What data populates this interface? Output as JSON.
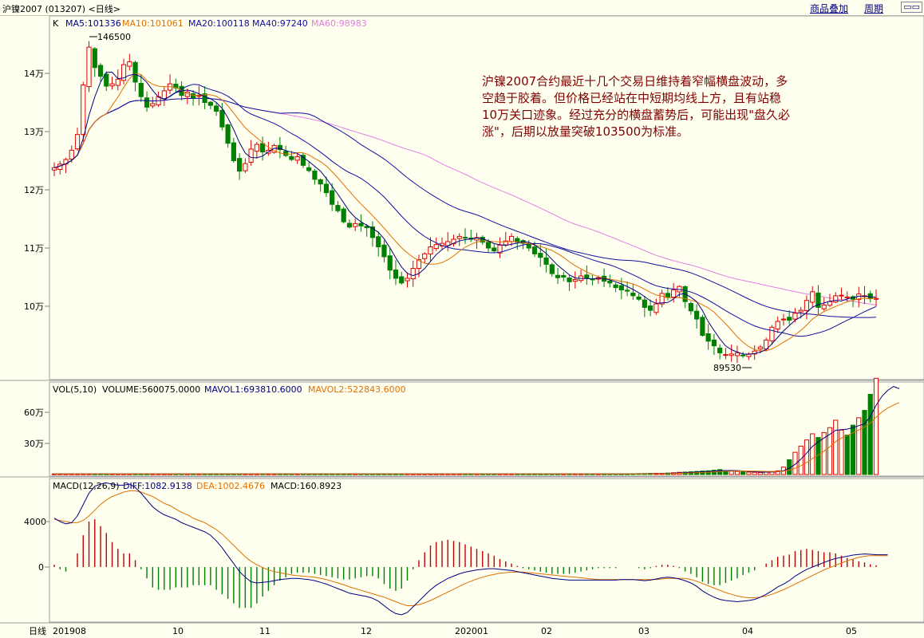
{
  "header": {
    "title": "沪镍2007 (013207) <日线>",
    "overlay_label": "商品叠加",
    "period_label": "周期",
    "window_icons": "▭▭"
  },
  "main_panel": {
    "k_label": "K",
    "ma": [
      {
        "label": "MA5:101336",
        "color": "#000080"
      },
      {
        "label": "MA10:101061",
        "color": "#e07000"
      },
      {
        "label": "MA20:100118",
        "color": "#1010a0"
      },
      {
        "label": "MA40:97240",
        "color": "#1010a0"
      },
      {
        "label": "MA60:98983",
        "color": "#e080e0"
      }
    ],
    "y_ticks": [
      "14万",
      "13万",
      "12万",
      "11万",
      "10万"
    ],
    "high_mark": "146500",
    "low_mark": "89530",
    "annotation": [
      "沪镍2007合约最近十几个交易日维持着窄幅横盘波动，多",
      "空趋于胶着。但价格已经站在中短期均线上方，且有站稳",
      "10万关口迹象。经过充分的横盘蓄势后，可能出现\"盘久必",
      "涨\"，后期以放量突破103500为标准。"
    ]
  },
  "vol_panel": {
    "label": "VOL(5,10)",
    "volume": "VOLUME:560075.0000",
    "mavol1": "MAVOL1:693810.6000",
    "mavol2": "MAVOL2:522843.6000",
    "y_ticks": [
      "60万",
      "30万"
    ]
  },
  "macd_panel": {
    "label": "MACD(12,26,9)",
    "diff": "DIFF:1082.9138",
    "dea": "DEA:1002.4676",
    "macd": "MACD:160.8923",
    "y_ticks": [
      "4000",
      "0"
    ]
  },
  "x_axis": {
    "period": "日线",
    "labels": [
      "201908",
      "10",
      "11",
      "12",
      "202001",
      "02",
      "03",
      "04",
      "05"
    ]
  },
  "chart_data": {
    "type": "candlestick",
    "price_ylim": [
      88000,
      148500
    ],
    "close_seq": [
      123800,
      124400,
      125200,
      126800,
      129500,
      138000,
      144500,
      141000,
      139500,
      137800,
      138200,
      139000,
      141500,
      142000,
      138500,
      136000,
      134200,
      134800,
      136000,
      137000,
      138200,
      137500,
      136200,
      136800,
      135800,
      136200,
      135000,
      134500,
      133500,
      130800,
      128000,
      125000,
      123200,
      124500,
      127000,
      127800,
      126500,
      126800,
      127600,
      126900,
      125900,
      125200,
      125700,
      124200,
      123300,
      121800,
      121000,
      119500,
      117500,
      116400,
      114500,
      113600,
      114200,
      113800,
      113500,
      111800,
      110200,
      108500,
      106200,
      104800,
      104000,
      104800,
      106500,
      108000,
      109000,
      110200,
      110600,
      110800,
      111100,
      111500,
      112000,
      111800,
      111500,
      111800,
      111000,
      110000,
      109500,
      110500,
      111200,
      112000,
      111000,
      110800,
      110000,
      109000,
      108400,
      107200,
      105600,
      104900,
      105000,
      104200,
      104600,
      105200,
      104800,
      104600,
      104900,
      104300,
      104000,
      103200,
      102800,
      102600,
      101800,
      101200,
      99800,
      99300,
      100400,
      102200,
      101500,
      102800,
      103400,
      100800,
      99200,
      97800,
      95000,
      94000,
      93200,
      92000,
      91700,
      91800,
      92000,
      91500,
      91800,
      92300,
      93000,
      94200,
      96400,
      97400,
      97800,
      97600,
      98800,
      99300,
      101000,
      102500,
      99800,
      100200,
      100800,
      101800,
      101900,
      101600,
      101200,
      102100,
      101800,
      101300,
      101336
    ],
    "vol_ylim": [
      0,
      750000
    ],
    "volume_seq": [
      5000,
      5000,
      5000,
      5000,
      5000,
      5000,
      5000,
      5000,
      5000,
      5000,
      5000,
      5000,
      5000,
      5000,
      5000,
      5000,
      5000,
      5000,
      5000,
      5000,
      5000,
      5000,
      5000,
      5000,
      5000,
      5000,
      5000,
      5000,
      5000,
      5000,
      5000,
      5000,
      5000,
      5000,
      5000,
      5000,
      5000,
      5000,
      5000,
      5000,
      5000,
      5000,
      5000,
      5000,
      5000,
      5000,
      5000,
      5000,
      5000,
      5000,
      5000,
      5000,
      5000,
      5000,
      5000,
      5000,
      5000,
      5000,
      5000,
      5000,
      5000,
      5000,
      5000,
      5000,
      5000,
      5000,
      5000,
      5000,
      5000,
      5000,
      5000,
      5000,
      5000,
      5000,
      5000,
      5000,
      5000,
      5000,
      5000,
      5000,
      5000,
      5000,
      5000,
      5000,
      5000,
      5000,
      5000,
      5000,
      5000,
      5000,
      5000,
      5000,
      5000,
      5000,
      5000,
      5000,
      5000,
      5000,
      5000,
      5000,
      6000,
      7000,
      8000,
      9000,
      10000,
      10000,
      12000,
      14000,
      18000,
      20000,
      22000,
      25000,
      28000,
      30000,
      35000,
      40000,
      30000,
      28000,
      25000,
      22000,
      20000,
      18000,
      16000,
      20000,
      25000,
      30000,
      60000,
      120000,
      180000,
      230000,
      280000,
      330000,
      300000,
      340000,
      380000,
      440000,
      360000,
      320000,
      400000,
      460000,
      520000,
      650000,
      780000,
      760000,
      700000,
      680000,
      560000
    ],
    "macd_ylim": [
      -5200,
      7800
    ],
    "diff_seq": [
      4300,
      4000,
      3800,
      3900,
      4500,
      5500,
      6500,
      7100,
      7300,
      7400,
      7300,
      7200,
      7200,
      7300,
      7000,
      6500,
      5900,
      5300,
      4900,
      4600,
      4400,
      4200,
      3900,
      3700,
      3500,
      3300,
      3100,
      2800,
      2300,
      1700,
      1000,
      300,
      -400,
      -900,
      -1300,
      -1400,
      -1350,
      -1300,
      -1200,
      -1100,
      -1050,
      -1000,
      -1000,
      -1050,
      -1100,
      -1200,
      -1350,
      -1500,
      -1700,
      -1900,
      -2100,
      -2300,
      -2400,
      -2500,
      -2600,
      -2750,
      -3000,
      -3400,
      -3800,
      -4100,
      -4200,
      -4000,
      -3500,
      -3000,
      -2500,
      -2000,
      -1600,
      -1300,
      -1000,
      -800,
      -600,
      -450,
      -350,
      -250,
      -200,
      -150,
      -150,
      -200,
      -250,
      -300,
      -400,
      -500,
      -600,
      -700,
      -800,
      -900,
      -1000,
      -1050,
      -1100,
      -1150,
      -1150,
      -1150,
      -1150,
      -1150,
      -1150,
      -1150,
      -1150,
      -1150,
      -1100,
      -1100,
      -1100,
      -1150,
      -1200,
      -1150,
      -1050,
      -950,
      -900,
      -950,
      -1050,
      -1200,
      -1400,
      -1700,
      -2100,
      -2400,
      -2650,
      -2850,
      -2950,
      -3000,
      -3050,
      -3000,
      -2950,
      -2850,
      -2650,
      -2400,
      -2100,
      -1750,
      -1500,
      -1200,
      -800,
      -500,
      -200,
      0,
      200,
      400,
      600,
      750,
      850,
      950,
      1050,
      1100,
      1150,
      1120,
      1080,
      1082,
      1082
    ],
    "dea_seq": [
      4200,
      4100,
      4000,
      3900,
      3900,
      4100,
      4500,
      5000,
      5500,
      5900,
      6200,
      6400,
      6600,
      6700,
      6700,
      6600,
      6400,
      6200,
      5900,
      5600,
      5400,
      5100,
      4800,
      4600,
      4300,
      4100,
      3900,
      3600,
      3300,
      2900,
      2400,
      1900,
      1400,
      900,
      500,
      200,
      -50,
      -250,
      -400,
      -500,
      -600,
      -700,
      -750,
      -800,
      -850,
      -900,
      -1000,
      -1100,
      -1250,
      -1400,
      -1550,
      -1750,
      -1900,
      -2050,
      -2200,
      -2350,
      -2500,
      -2650,
      -2850,
      -3050,
      -3250,
      -3400,
      -3400,
      -3300,
      -3150,
      -2950,
      -2700,
      -2450,
      -2200,
      -1950,
      -1700,
      -1450,
      -1250,
      -1050,
      -900,
      -750,
      -650,
      -550,
      -500,
      -450,
      -450,
      -450,
      -500,
      -550,
      -600,
      -650,
      -700,
      -750,
      -800,
      -850,
      -900,
      -950,
      -1000,
      -1050,
      -1100,
      -1100,
      -1100,
      -1100,
      -1100,
      -1100,
      -1100,
      -1100,
      -1100,
      -1100,
      -1100,
      -1050,
      -1000,
      -1000,
      -1000,
      -1000,
      -1100,
      -1250,
      -1450,
      -1650,
      -1850,
      -2050,
      -2250,
      -2400,
      -2550,
      -2650,
      -2700,
      -2700,
      -2650,
      -2550,
      -2400,
      -2200,
      -2000,
      -1750,
      -1500,
      -1250,
      -1000,
      -750,
      -500,
      -250,
      -50,
      150,
      350,
      550,
      700,
      850,
      950,
      1000,
      1002,
      1002,
      1002
    ],
    "x_ticks": [
      "201908",
      "10",
      "11",
      "12",
      "202001",
      "02",
      "03",
      "04",
      "05"
    ]
  }
}
